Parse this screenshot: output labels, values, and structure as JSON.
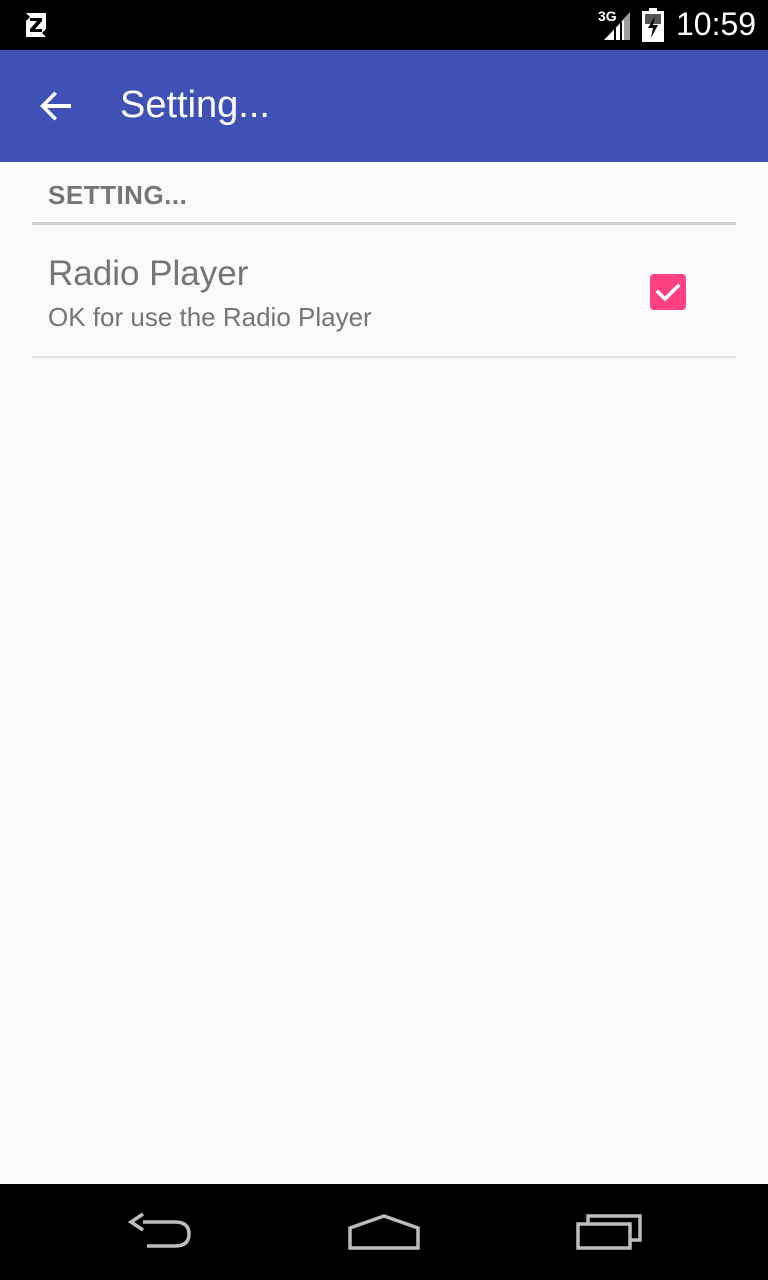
{
  "status_bar": {
    "network_type": "3G",
    "time": "10:59",
    "icons": [
      "notification-z-icon",
      "signal-icon",
      "battery-charging-icon"
    ]
  },
  "toolbar": {
    "title": "Setting...",
    "back_icon": "arrow-back-icon",
    "color": "#3f51b5"
  },
  "preferences": {
    "category_title": "SETTING...",
    "items": [
      {
        "title": "Radio Player",
        "summary": "OK for use the Radio Player",
        "checked": true,
        "accent_color": "#ff4081"
      }
    ]
  },
  "nav_bar": {
    "icons": [
      "nav-back-icon",
      "nav-home-icon",
      "nav-recents-icon"
    ]
  }
}
